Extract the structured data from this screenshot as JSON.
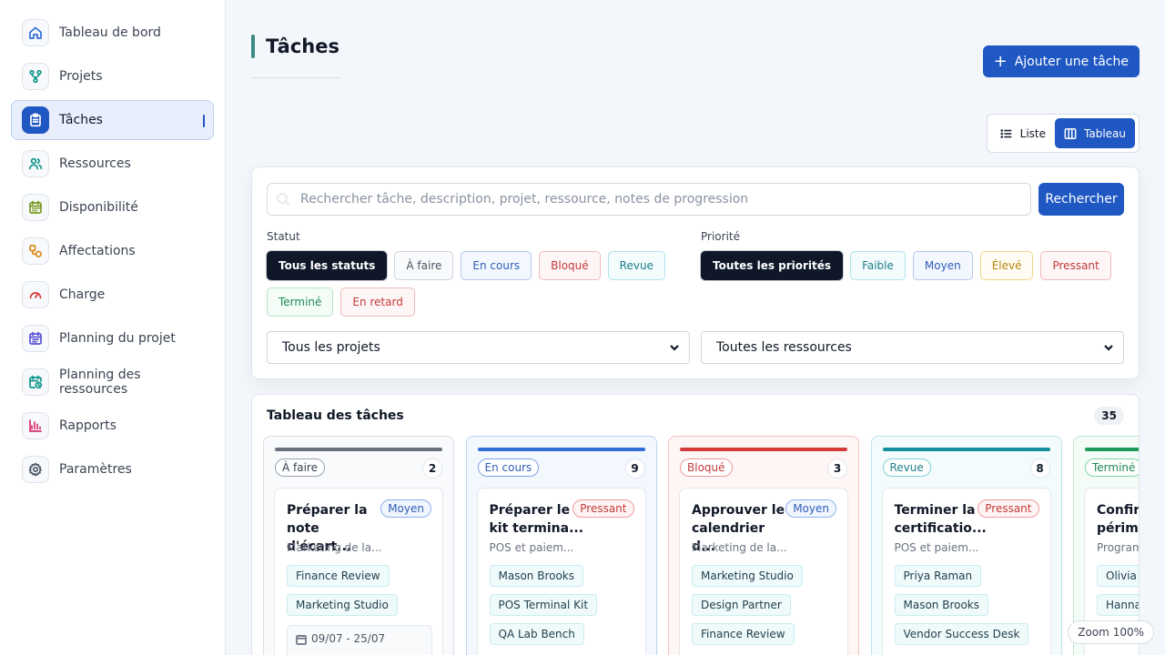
{
  "sidebar": {
    "items": [
      {
        "label": "Tableau de bord",
        "icon": "home-icon",
        "color": "#2f6fd6",
        "active": false
      },
      {
        "label": "Projets",
        "icon": "branch-icon",
        "color": "#11968a",
        "active": false
      },
      {
        "label": "Tâches",
        "icon": "clipboard-icon",
        "color": "#ffffff",
        "active": true
      },
      {
        "label": "Ressources",
        "icon": "users-icon",
        "color": "#11968a",
        "active": false
      },
      {
        "label": "Disponibilité",
        "icon": "calendar-icon",
        "color": "#7a9a23",
        "active": false
      },
      {
        "label": "Affectations",
        "icon": "assign-icon",
        "color": "#d98a12",
        "active": false
      },
      {
        "label": "Charge",
        "icon": "gauge-icon",
        "color": "#d63b3b",
        "active": false
      },
      {
        "label": "Planning du projet",
        "icon": "calendar-list-icon",
        "color": "#5b54d6",
        "active": false
      },
      {
        "label": "Planning des ressources",
        "icon": "calendar-clock-icon",
        "color": "#11968a",
        "active": false
      },
      {
        "label": "Rapports",
        "icon": "bar-chart-icon",
        "color": "#d6336c",
        "active": false
      },
      {
        "label": "Paramètres",
        "icon": "gear-icon",
        "color": "#4b5563",
        "active": false
      }
    ]
  },
  "header": {
    "title": "Tâches",
    "add_button": "Ajouter une tâche",
    "view_list": "Liste",
    "view_board": "Tableau"
  },
  "search": {
    "placeholder": "Rechercher tâche, description, projet, ressource, notes de progression",
    "button": "Rechercher"
  },
  "filters": {
    "status_label": "Statut",
    "status": [
      {
        "label": "Tous les statuts",
        "selected": true,
        "border": "#0f1729",
        "color": "#ffffff",
        "bg": "#0f1729"
      },
      {
        "label": "À faire",
        "selected": false,
        "border": "#cfd5de",
        "color": "#4b5563",
        "bg": "#f8fafc"
      },
      {
        "label": "En cours",
        "selected": false,
        "border": "#b5c8ee",
        "color": "#2f5db8",
        "bg": "#f3f7fe"
      },
      {
        "label": "Bloqué",
        "selected": false,
        "border": "#f0b9b9",
        "color": "#c33a3a",
        "bg": "#fef6f6"
      },
      {
        "label": "Revue",
        "selected": false,
        "border": "#aee3ea",
        "color": "#1f7f8a",
        "bg": "#f3fbfc"
      },
      {
        "label": "Terminé",
        "selected": false,
        "border": "#b3e6c8",
        "color": "#1f8a55",
        "bg": "#f3fcf7"
      },
      {
        "label": "En retard",
        "selected": false,
        "border": "#f0b9b9",
        "color": "#c33a3a",
        "bg": "#fef6f6"
      }
    ],
    "priority_label": "Priorité",
    "priority": [
      {
        "label": "Toutes les priorités",
        "selected": true,
        "border": "#0f1729",
        "color": "#ffffff",
        "bg": "#0f1729"
      },
      {
        "label": "Faible",
        "selected": false,
        "border": "#aee3ea",
        "color": "#1f7f8a",
        "bg": "#f3fbfc"
      },
      {
        "label": "Moyen",
        "selected": false,
        "border": "#b5c8ee",
        "color": "#2f5db8",
        "bg": "#f3f7fe"
      },
      {
        "label": "Élevé",
        "selected": false,
        "border": "#f2d58a",
        "color": "#b8860b",
        "bg": "#fffcf3"
      },
      {
        "label": "Pressant",
        "selected": false,
        "border": "#f0b9b9",
        "color": "#c33a3a",
        "bg": "#fef6f6"
      }
    ],
    "project_select": "Tous les projets",
    "resource_select": "Toutes les ressources"
  },
  "board": {
    "title": "Tableau des tâches",
    "count": "35",
    "columns": [
      {
        "name": "À faire",
        "count": "2",
        "bar": "#6b7280",
        "border": "#d9dee6",
        "bg": "#f8fafc",
        "badge_border": "#9aa3b0",
        "badge_color": "#374151",
        "task": {
          "title": "Préparer la note d'écart...",
          "priority": "Moyen",
          "prio_border": "#8fb0ea",
          "prio_color": "#2f5db8",
          "prio_bg": "#f0f5fe",
          "project": "Marketing de la...",
          "resources": [
            "Finance Review",
            "Marketing Studio"
          ],
          "dates": "09/07 - 25/07"
        }
      },
      {
        "name": "En cours",
        "count": "9",
        "bar": "#2f6fd6",
        "border": "#bcd2f3",
        "bg": "#f3f7fe",
        "badge_border": "#7fa4e6",
        "badge_color": "#2f5db8",
        "task": {
          "title": "Préparer le kit termina...",
          "priority": "Pressant",
          "prio_border": "#ef9c9c",
          "prio_color": "#c33a3a",
          "prio_bg": "#fef4f4",
          "project": "POS et paiem...",
          "resources": [
            "Mason Brooks",
            "POS Terminal Kit",
            "QA Lab Bench"
          ],
          "dates": ""
        }
      },
      {
        "name": "Bloqué",
        "count": "3",
        "bar": "#d63b3b",
        "border": "#f3c3c3",
        "bg": "#fef5f5",
        "badge_border": "#ea9a9a",
        "badge_color": "#c33a3a",
        "task": {
          "title": "Approuver le calendrier d...",
          "priority": "Moyen",
          "prio_border": "#8fb0ea",
          "prio_color": "#2f5db8",
          "prio_bg": "#f0f5fe",
          "project": "Marketing de la...",
          "resources": [
            "Marketing Studio",
            "Design Partner",
            "Finance Review"
          ],
          "dates": ""
        }
      },
      {
        "name": "Revue",
        "count": "8",
        "bar": "#14909b",
        "border": "#b8e5ea",
        "bg": "#f3fbfc",
        "badge_border": "#7fd0da",
        "badge_color": "#1f7f8a",
        "task": {
          "title": "Terminer la certificatio...",
          "priority": "Pressant",
          "prio_border": "#ef9c9c",
          "prio_color": "#c33a3a",
          "prio_bg": "#fef4f4",
          "project": "POS et paiem...",
          "resources": [
            "Priya Raman",
            "Mason Brooks",
            "Vendor Success Desk"
          ],
          "dates": ""
        }
      },
      {
        "name": "Terminé",
        "count": "",
        "bar": "#1f9a5b",
        "border": "#bfe8d0",
        "bg": "#f3fcf7",
        "badge_border": "#86d3a8",
        "badge_color": "#1f8a55",
        "task": {
          "title": "Confirm périmè",
          "priority": "",
          "prio_border": "#ffffff",
          "prio_color": "#ffffff",
          "prio_bg": "#ffffff",
          "project": "Program",
          "resources": [
            "Olivia C",
            "Hannal"
          ],
          "dates": ""
        }
      }
    ]
  },
  "zoom": "Zoom 100%"
}
